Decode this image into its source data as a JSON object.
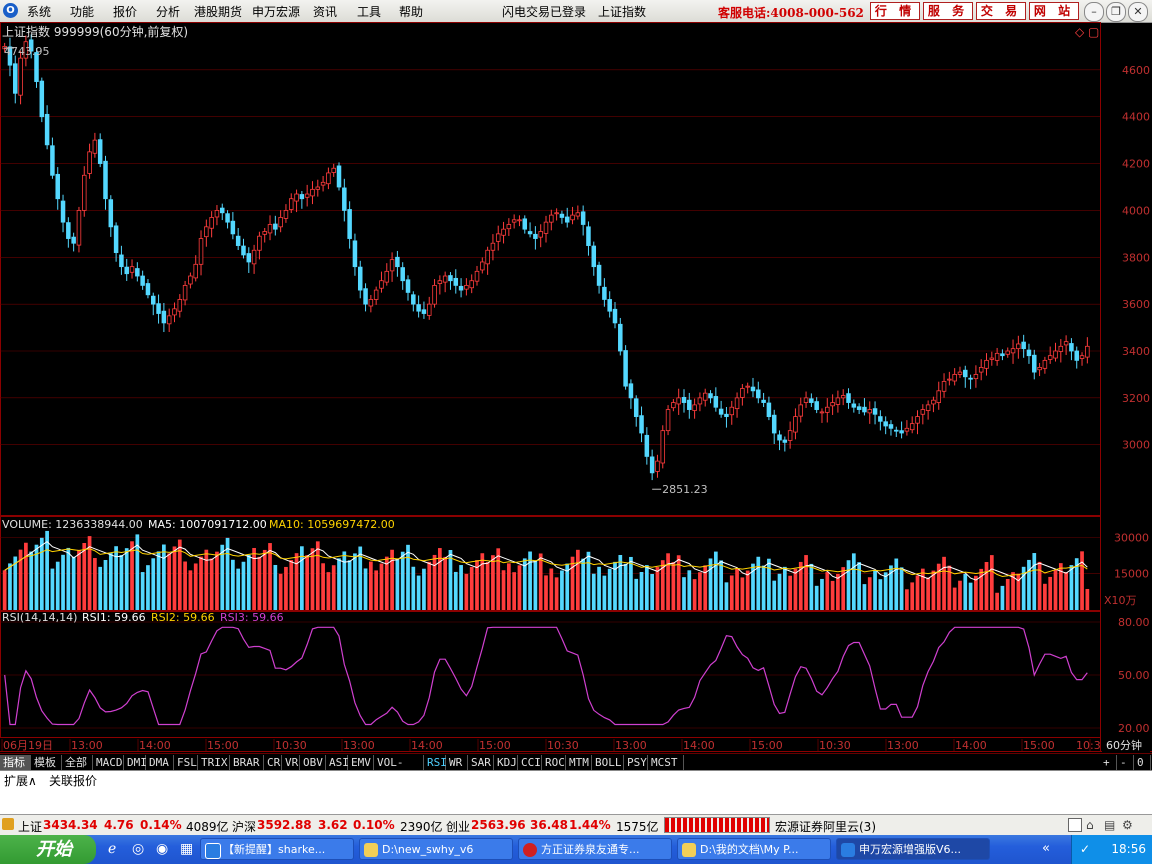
{
  "menubar": {
    "items": [
      "系统",
      "功能",
      "报价",
      "分析",
      "港股期货",
      "申万宏源",
      "资讯",
      "工具",
      "帮助"
    ],
    "login_status": "闪电交易已登录",
    "index_name": "上证指数",
    "hotline": "客服电话:4008-000-562",
    "buttons": [
      "行 情",
      "服 务",
      "交 易",
      "网 站"
    ]
  },
  "chart": {
    "title": "上证指数 999999(60分钟,前复权)",
    "high_label": "4743.95",
    "low_label": "2851.23",
    "volume_header": {
      "label": "VOLUME: 1236338944.00",
      "ma5": "MA5: 1007091712.00",
      "ma10": "MA10: 1059697472.00"
    },
    "volume_unit": "X10万",
    "rsi_header": {
      "label": "RSI(14,14,14)",
      "rsi1": "RSI1: 59.66",
      "rsi2": "RSI2: 59.66",
      "rsi3": "RSI3: 59.66"
    },
    "period_button": "60分钟",
    "colors": {
      "up": "#ff3c3c",
      "down": "#54d8ff",
      "grid": "#6a0000",
      "axis_text": "#c03030",
      "ma5": "#ffffff",
      "ma10": "#ffd200",
      "rsi": "#d040d0"
    }
  },
  "chart_data": [
    {
      "type": "candlestick",
      "title": "上证指数 999999(60分钟,前复权)",
      "ylim": [
        2700,
        4800
      ],
      "y_ticks": [
        3000,
        3200,
        3400,
        3600,
        3800,
        4000,
        4200,
        4400,
        4600
      ],
      "annotations": [
        {
          "label": "4743.95",
          "type": "high"
        },
        {
          "label": "2851.23",
          "type": "low"
        }
      ],
      "close_series": [
        4700,
        4620,
        4500,
        4650,
        4720,
        4680,
        4550,
        4400,
        4280,
        4150,
        4050,
        3950,
        3880,
        3860,
        4000,
        4150,
        4250,
        4300,
        4200,
        4050,
        3930,
        3820,
        3760,
        3730,
        3760,
        3720,
        3680,
        3640,
        3600,
        3560,
        3520,
        3550,
        3580,
        3620,
        3680,
        3720,
        3770,
        3880,
        3930,
        3970,
        4000,
        3990,
        3950,
        3900,
        3850,
        3810,
        3780,
        3830,
        3890,
        3910,
        3940,
        3920,
        3970,
        4000,
        4050,
        4070,
        4050,
        4070,
        4090,
        4100,
        4120,
        4160,
        4180,
        4100,
        4000,
        3880,
        3760,
        3660,
        3600,
        3620,
        3660,
        3700,
        3740,
        3790,
        3760,
        3700,
        3650,
        3600,
        3570,
        3560,
        3600,
        3680,
        3700,
        3720,
        3700,
        3680,
        3660,
        3680,
        3700,
        3740,
        3780,
        3830,
        3860,
        3900,
        3920,
        3940,
        3960,
        3960,
        3920,
        3900,
        3880,
        3910,
        3950,
        3980,
        3990,
        3970,
        3950,
        3980,
        3990,
        3940,
        3850,
        3760,
        3680,
        3620,
        3570,
        3520,
        3400,
        3250,
        3200,
        3120,
        3050,
        2950,
        2880,
        2930,
        3060,
        3150,
        3180,
        3200,
        3180,
        3150,
        3170,
        3200,
        3220,
        3200,
        3160,
        3130,
        3120,
        3160,
        3200,
        3240,
        3250,
        3230,
        3200,
        3180,
        3120,
        3050,
        3020,
        3010,
        3060,
        3120,
        3170,
        3200,
        3180,
        3150,
        3140,
        3160,
        3180,
        3200,
        3210,
        3180,
        3160,
        3150,
        3140,
        3150,
        3130,
        3100,
        3080,
        3070,
        3060,
        3050,
        3070,
        3090,
        3120,
        3150,
        3170,
        3190,
        3230,
        3270,
        3280,
        3300,
        3310,
        3290,
        3280,
        3300,
        3330,
        3360,
        3370,
        3390,
        3380,
        3400,
        3410,
        3430,
        3410,
        3380,
        3310,
        3330,
        3360,
        3380,
        3400,
        3420,
        3440,
        3400,
        3360,
        3380,
        3420
      ]
    },
    {
      "type": "bar",
      "title": "VOLUME",
      "ylabel": "X10万",
      "y_ticks": [
        15000,
        30000
      ],
      "series": [
        {
          "name": "VOLUME",
          "latest": 12363.38944
        },
        {
          "name": "MA5",
          "latest": 10070.91712
        },
        {
          "name": "MA10",
          "latest": 10596.97472
        }
      ]
    },
    {
      "type": "line",
      "title": "RSI(14,14,14)",
      "ylim": [
        20,
        80
      ],
      "y_ticks": [
        20,
        50,
        80
      ],
      "series": [
        {
          "name": "RSI1",
          "latest": 59.66
        },
        {
          "name": "RSI2",
          "latest": 59.66
        },
        {
          "name": "RSI3",
          "latest": 59.66
        }
      ],
      "x_ticks": [
        "06月19日",
        "13:00",
        "14:00",
        "15:00",
        "10:30",
        "13:00",
        "14:00",
        "15:00",
        "10:30",
        "13:00",
        "14:00",
        "15:00",
        "10:30",
        "13:00",
        "14:00",
        "15:00",
        "10:3"
      ]
    }
  ],
  "indicator_tabs": {
    "lead": [
      "指标",
      "模板",
      "全部"
    ],
    "items": [
      "MACD",
      "DMI",
      "DMA",
      "FSL",
      "TRIX",
      "BRAR",
      "CR",
      "VR",
      "OBV",
      "ASI",
      "EMV",
      "VOL-TDX",
      "RSI",
      "WR",
      "SAR",
      "KDJ",
      "CCI",
      "ROC",
      "MTM",
      "BOLL",
      "PSY",
      "MCST"
    ],
    "right": [
      "+",
      "-",
      "0"
    ]
  },
  "lower_tabs": [
    "扩展∧",
    "关联报价"
  ],
  "statusbar": {
    "sh_label": "上证",
    "sh_value": "3434.34",
    "sh_change": "4.76",
    "sh_pct": "0.14%",
    "sh_amount": "4089亿",
    "hs_label": "沪深",
    "hs_value": "3592.88",
    "hs_change": "3.62",
    "hs_pct": "0.10%",
    "hs_amount": "2390亿",
    "cy_label": "创业",
    "cy_value": "2563.96",
    "cy_change": "36.48",
    "cy_pct": "1.44%",
    "cy_amount": "1575亿",
    "server": "宏源证券阿里云(3)"
  },
  "taskbar": {
    "start": "开始",
    "tasks": [
      "【新提醒】sharke...",
      "D:\\new_swhy_v6",
      "方正证券泉友通专...",
      "D:\\我的文档\\My P...",
      "申万宏源增强版V6..."
    ],
    "clock": "18:56"
  }
}
